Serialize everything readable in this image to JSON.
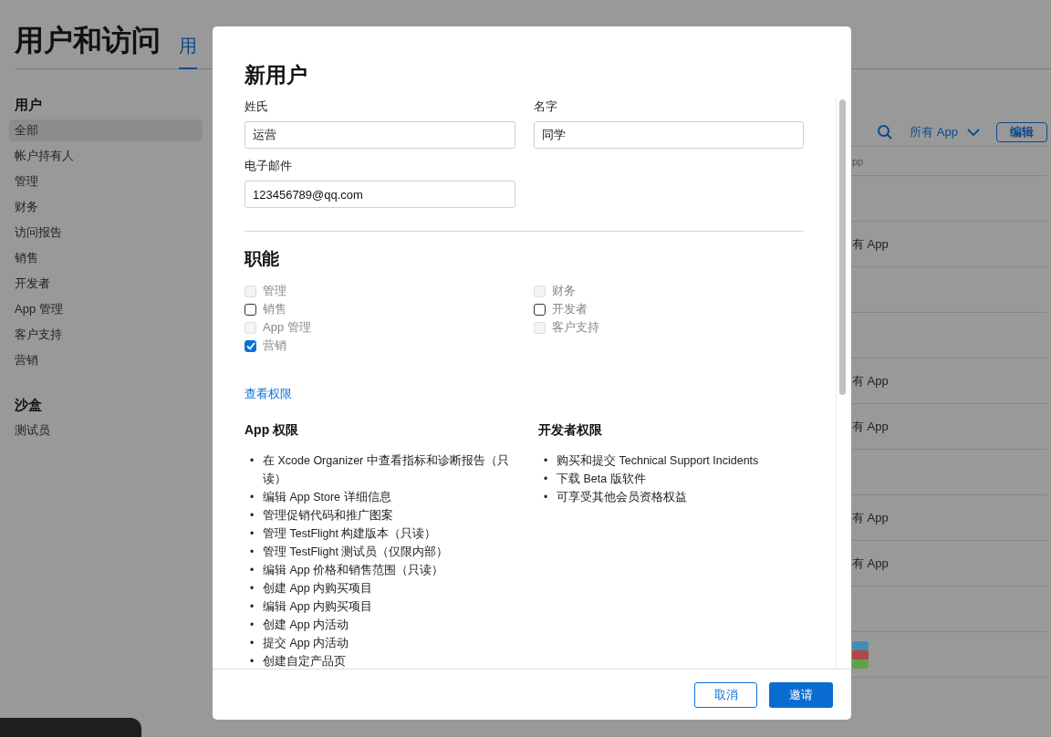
{
  "page": {
    "title": "用户和访问",
    "tabs": [
      {
        "label": "用",
        "selected": true
      }
    ]
  },
  "sidebar": {
    "sections": [
      {
        "heading": "用户",
        "items": [
          {
            "label": "全部",
            "selected": true
          },
          {
            "label": "帐户持有人",
            "selected": false
          },
          {
            "label": "管理",
            "selected": false
          },
          {
            "label": "财务",
            "selected": false
          },
          {
            "label": "访问报告",
            "selected": false
          },
          {
            "label": "销售",
            "selected": false
          },
          {
            "label": "开发者",
            "selected": false
          },
          {
            "label": "App 管理",
            "selected": false
          },
          {
            "label": "客户支持",
            "selected": false
          },
          {
            "label": "营销",
            "selected": false
          }
        ]
      },
      {
        "heading": "沙盒",
        "items": [
          {
            "label": "测试员",
            "selected": false
          }
        ]
      }
    ]
  },
  "toolbar": {
    "filter": "所有 App",
    "edit_button": "编辑"
  },
  "table": {
    "columns": [
      "pp"
    ],
    "rows": [
      {
        "kind": "empty"
      },
      {
        "kind": "text",
        "apps": "有 App"
      },
      {
        "kind": "empty"
      },
      {
        "kind": "empty"
      },
      {
        "kind": "text",
        "apps": "有 App"
      },
      {
        "kind": "text",
        "apps": "有 App"
      },
      {
        "kind": "empty"
      },
      {
        "kind": "text",
        "apps": "有 App"
      },
      {
        "kind": "text",
        "apps": "有 App"
      },
      {
        "kind": "empty"
      },
      {
        "kind": "icon"
      }
    ]
  },
  "modal": {
    "title": "新用户",
    "fields": [
      {
        "label": "姓氏",
        "value": "运营"
      },
      {
        "label": "名字",
        "value": "同学"
      },
      {
        "label": "电子邮件",
        "value": "123456789@qq.com"
      }
    ],
    "roles_heading": "职能",
    "role_columns": [
      [
        {
          "label": "管理",
          "checked": false,
          "disabled": true
        },
        {
          "label": "销售",
          "checked": false,
          "disabled": false
        },
        {
          "label": "App 管理",
          "checked": false,
          "disabled": true
        },
        {
          "label": "营销",
          "checked": true,
          "disabled": false
        }
      ],
      [
        {
          "label": "财务",
          "checked": false,
          "disabled": true
        },
        {
          "label": "开发者",
          "checked": false,
          "disabled": false
        },
        {
          "label": "客户支持",
          "checked": false,
          "disabled": true
        }
      ]
    ],
    "view_permissions": "查看权限",
    "permissions": [
      {
        "heading": "App 权限",
        "bullet": "•",
        "items": [
          "在 Xcode Organizer 中查看指标和诊断报告（只读）",
          "编辑 App Store 详细信息",
          "管理促销代码和推广图案",
          "管理 TestFlight 构建版本（只读）",
          "管理 TestFlight 测试员（仅限内部）",
          "编辑 App 价格和销售范围（只读）",
          "创建 App 内购买项目",
          "编辑 App 内购买项目",
          "创建 App 内活动",
          "提交 App 内活动",
          "创建自定产品页"
        ]
      },
      {
        "heading": "开发者权限",
        "bullet": "•",
        "items": [
          "购买和提交 Technical Support Incidents",
          "下载 Beta 版软件",
          "可享受其他会员资格权益"
        ]
      }
    ],
    "cancel_button": "取消",
    "invite_button": "邀请"
  }
}
